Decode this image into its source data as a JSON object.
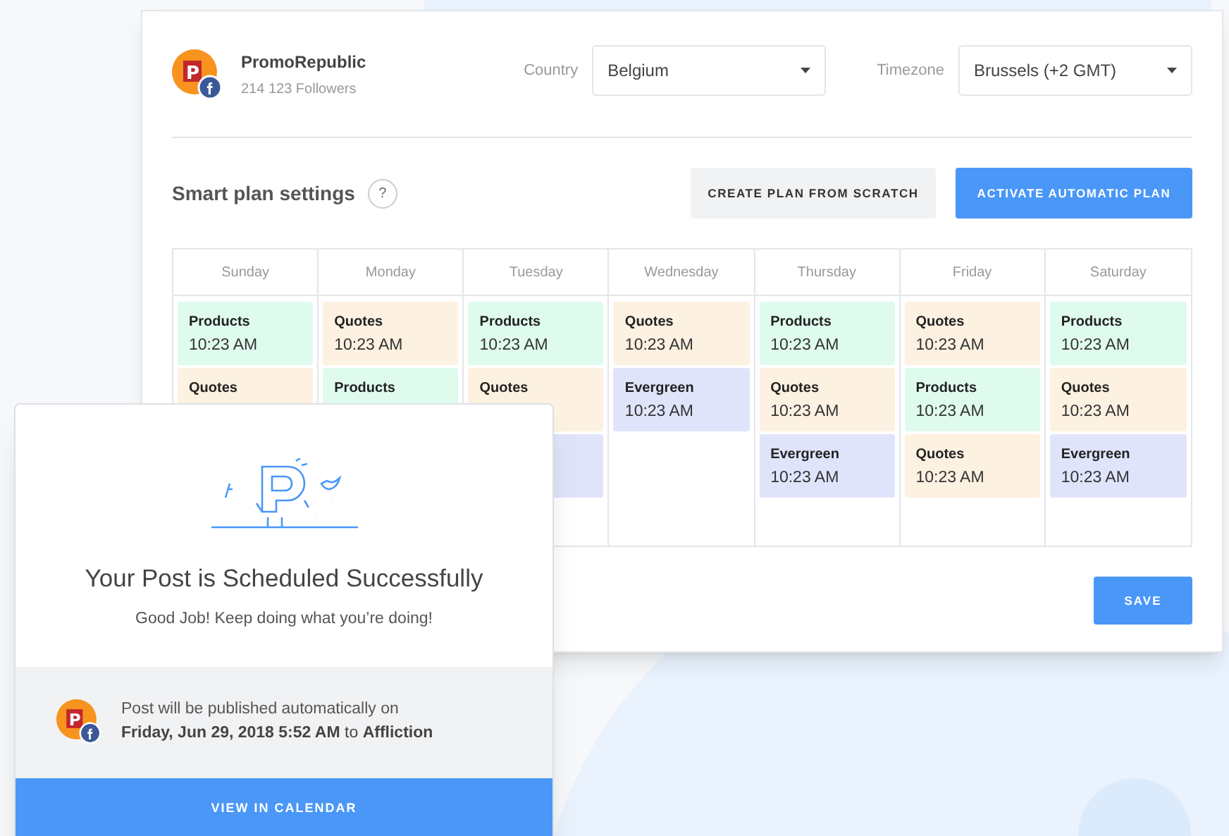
{
  "account": {
    "logo": "P",
    "name": "PromoRepublic",
    "followers": "214 123 Followers"
  },
  "filters": [
    {
      "label": "Country",
      "value": "Belgium"
    },
    {
      "label": "Timezone",
      "value": "Brussels (+2 GMT)"
    }
  ],
  "plan": {
    "title": "Smart plan settings",
    "help": "?",
    "buttons": [
      {
        "label": "CREATE PLAN FROM SCRATCH",
        "kind": "secondary"
      },
      {
        "label": "ACTIVATE AUTOMATIC PLAN",
        "kind": "primary"
      }
    ]
  },
  "days": [
    {
      "name": "Sunday",
      "slots": [
        {
          "kind": "products",
          "label": "Products",
          "time": "10:23 AM"
        },
        {
          "kind": "quotes",
          "label": "Quotes"
        }
      ]
    },
    {
      "name": "Monday",
      "slots": [
        {
          "kind": "quotes",
          "label": "Quotes",
          "time": "10:23 AM"
        },
        {
          "kind": "products",
          "label": "Products"
        }
      ]
    },
    {
      "name": "Tuesday",
      "slots": [
        {
          "kind": "products",
          "label": "Products",
          "time": "10:23 AM"
        },
        {
          "kind": "quotes",
          "label": "Quotes"
        },
        {
          "kind": "evergreen"
        }
      ]
    },
    {
      "name": "Wednesday",
      "slots": [
        {
          "kind": "quotes",
          "label": "Quotes",
          "time": "10:23 AM"
        },
        {
          "kind": "evergreen",
          "label": "Evergreen",
          "time": "10:23 AM"
        }
      ]
    },
    {
      "name": "Thursday",
      "slots": [
        {
          "kind": "products",
          "label": "Products",
          "time": "10:23 AM"
        },
        {
          "kind": "quotes",
          "label": "Quotes",
          "time": "10:23 AM"
        },
        {
          "kind": "evergreen",
          "label": "Evergreen",
          "time": "10:23 AM"
        }
      ]
    },
    {
      "name": "Friday",
      "slots": [
        {
          "kind": "quotes",
          "label": "Quotes",
          "time": "10:23 AM"
        },
        {
          "kind": "products",
          "label": "Products",
          "time": "10:23 AM"
        },
        {
          "kind": "quotes",
          "label": "Quotes",
          "time": "10:23 AM"
        }
      ]
    },
    {
      "name": "Saturday",
      "slots": [
        {
          "kind": "products",
          "label": "Products",
          "time": "10:23 AM"
        },
        {
          "kind": "quotes",
          "label": "Quotes",
          "time": "10:23 AM"
        },
        {
          "kind": "evergreen",
          "label": "Evergreen",
          "time": "10:23 AM"
        }
      ]
    }
  ],
  "save": "SAVE",
  "modal": {
    "logo": "P",
    "title": "Your Post is Scheduled Successfully",
    "subtitle": "Good Job! Keep doing what you’re doing!",
    "info_line": "Post will be published automatically on",
    "schedule": "**Friday, Jun 29, 2018 5:52 AM** to **Affliction**",
    "action": "VIEW IN CALENDAR"
  }
}
